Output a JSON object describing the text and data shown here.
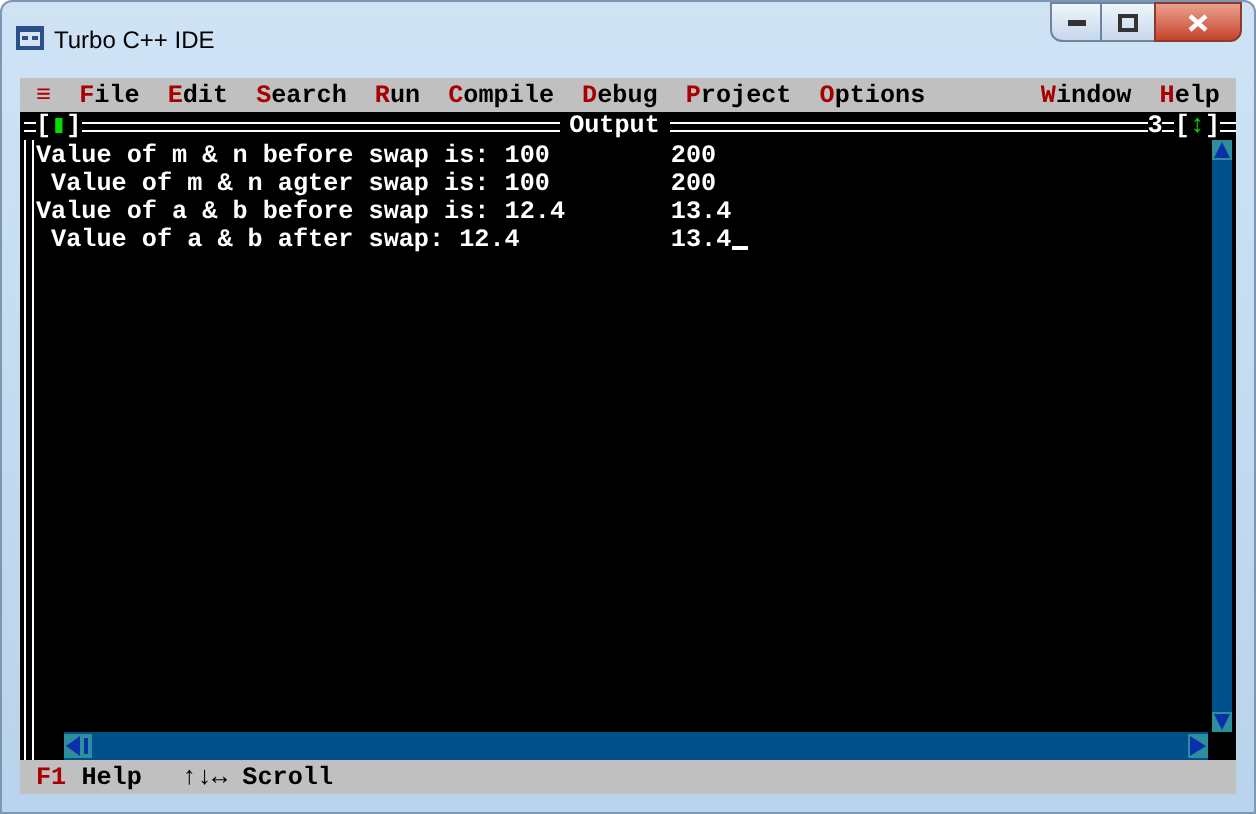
{
  "window": {
    "title": "Turbo C++ IDE"
  },
  "menu": {
    "left": [
      "≡",
      "File",
      "Edit",
      "Search",
      "Run",
      "Compile",
      "Debug",
      "Project",
      "Options"
    ],
    "right": [
      "Window",
      "Help"
    ]
  },
  "output_window": {
    "close_button": "[▮]",
    "title": "Output",
    "number": "3",
    "zoom_button": "[↕]",
    "lines": [
      "Value of m & n before swap is: 100        200",
      " Value of m & n agter swap is: 100        200",
      "Value of a & b before swap is: 12.4       13.4",
      " Value of a & b after swap: 12.4          13.4"
    ]
  },
  "status_bar": [
    {
      "key": "F1",
      "label": "Help"
    },
    {
      "label": "↑↓↔ Scroll"
    }
  ]
}
